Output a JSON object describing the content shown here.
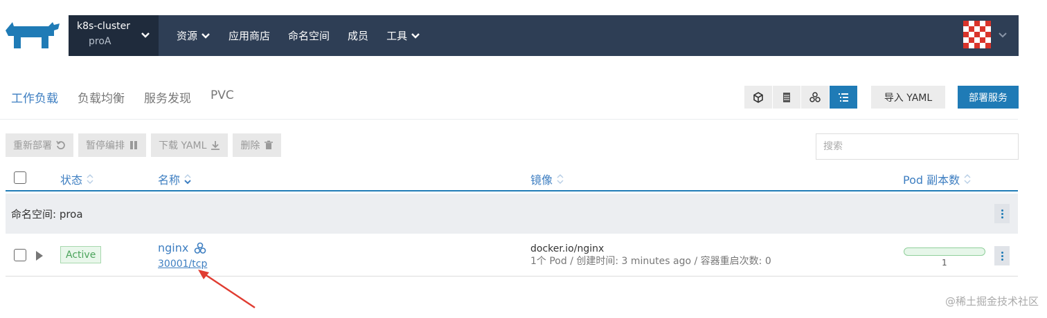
{
  "header": {
    "cluster_name": "k8s-cluster",
    "project_name": "proA",
    "nav": [
      {
        "label": "资源",
        "dropdown": true
      },
      {
        "label": "应用商店",
        "dropdown": false
      },
      {
        "label": "命名空间",
        "dropdown": false
      },
      {
        "label": "成员",
        "dropdown": false
      },
      {
        "label": "工具",
        "dropdown": true
      }
    ],
    "bg_color": "#2e3e55"
  },
  "tabs": [
    "工作负载",
    "负载均衡",
    "服务发现",
    "PVC"
  ],
  "active_tab": "工作负载",
  "toolbar": {
    "view_icons": [
      "cube-icon",
      "server-icon",
      "nodes-icon",
      "list-icon"
    ],
    "import_label": "导入 YAML",
    "deploy_label": "部署服务",
    "accent": "#1f7bb6"
  },
  "actions": [
    {
      "label": "重新部署",
      "icon": "redeploy-icon"
    },
    {
      "label": "暂停编排",
      "icon": "pause-icon"
    },
    {
      "label": "下载 YAML",
      "icon": "download-icon"
    },
    {
      "label": "删除",
      "icon": "trash-icon"
    }
  ],
  "search": {
    "placeholder": "搜索"
  },
  "table": {
    "columns": [
      "状态",
      "名称",
      "镜像",
      "Pod 副本数"
    ],
    "group_label": "命名空间: proa",
    "rows": [
      {
        "status": "Active",
        "name": "nginx",
        "port": "30001/tcp",
        "image": "docker.io/nginx",
        "meta": "1个 Pod / 创建时间: 3 minutes ago / 容器重启次数: 0",
        "pod_count": "1"
      }
    ]
  },
  "watermark": "@稀土掘金技术社区"
}
